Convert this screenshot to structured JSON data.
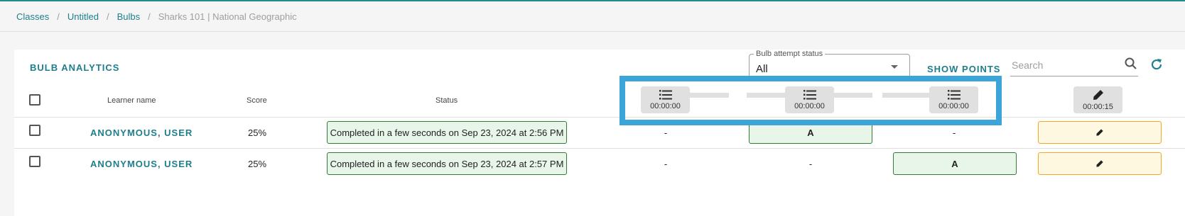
{
  "breadcrumb": {
    "items": [
      {
        "label": "Classes"
      },
      {
        "label": "Untitled"
      },
      {
        "label": "Bulbs"
      }
    ],
    "separator": "/",
    "current": "Sharks 101 | National Geographic"
  },
  "analytics": {
    "title": "BULB ANALYTICS",
    "status_filter": {
      "label": "Bulb attempt status",
      "value": "All"
    },
    "show_points_label": "SHOW POINTS",
    "search": {
      "placeholder": "Search",
      "value": ""
    }
  },
  "table": {
    "headers": {
      "learner": "Learner name",
      "score": "Score",
      "status": "Status"
    },
    "question_columns": [
      {
        "icon": "list-icon",
        "time": "00:00:00"
      },
      {
        "icon": "list-icon",
        "time": "00:00:00"
      },
      {
        "icon": "list-icon",
        "time": "00:00:00"
      },
      {
        "icon": "pencil-icon",
        "time": "00:00:15"
      }
    ],
    "rows": [
      {
        "learner": "ANONYMOUS, USER",
        "score": "25%",
        "status": "Completed in a few seconds on Sep 23, 2024 at 2:56 PM",
        "answers": [
          "-",
          "A",
          "-"
        ]
      },
      {
        "learner": "ANONYMOUS, USER",
        "score": "25%",
        "status": "Completed in a few seconds on Sep 23, 2024 at 2:57 PM",
        "answers": [
          "-",
          "-",
          "A"
        ]
      }
    ]
  },
  "colors": {
    "accent": "#1e7e8c",
    "highlight": "#3ba4d9",
    "correct_fill": "#e8f5e9",
    "correct_border": "#2e7d32",
    "open_fill": "#fff8e1",
    "open_border": "#f5a623"
  }
}
